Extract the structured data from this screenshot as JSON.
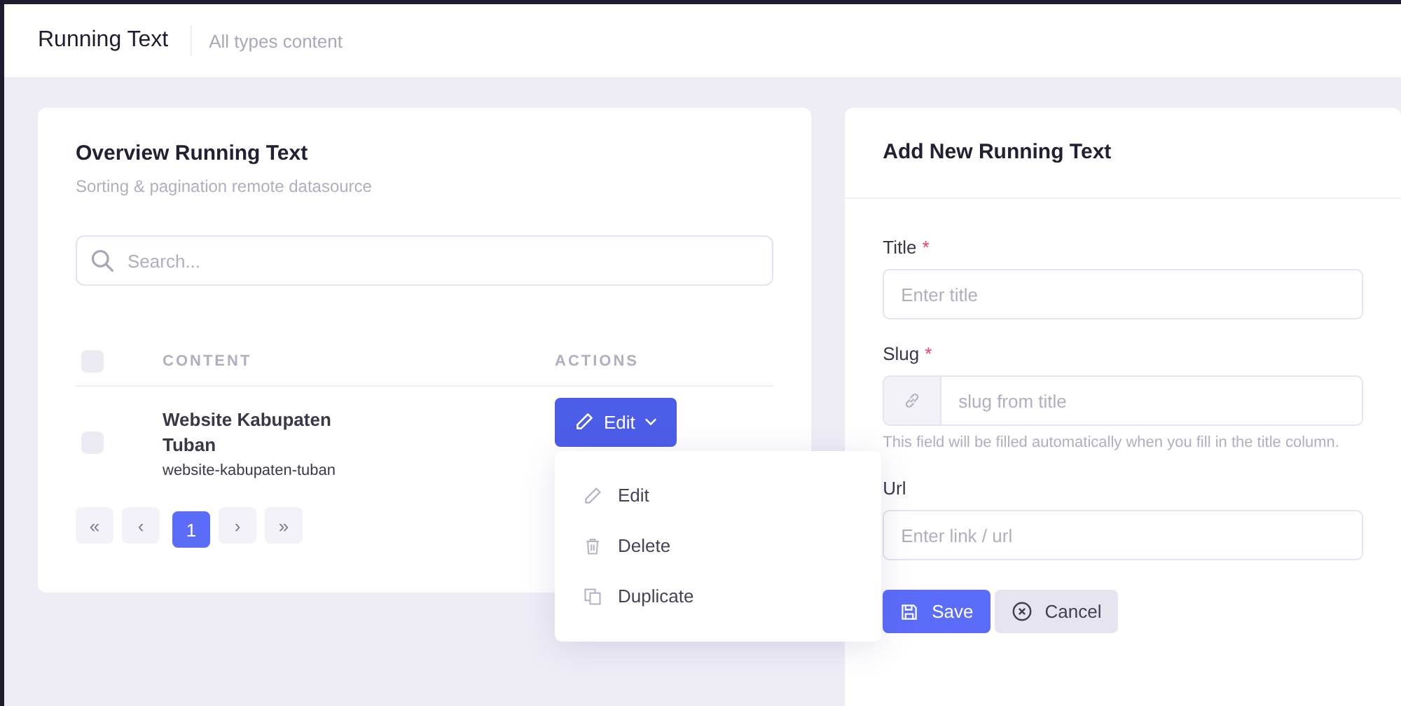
{
  "header": {
    "title": "Running Text",
    "subtitle": "All types content"
  },
  "overview": {
    "title": "Overview Running Text",
    "subtitle": "Sorting & pagination remote datasource",
    "search": {
      "placeholder": "Search..."
    },
    "table": {
      "select_all": {
        "checked": false
      },
      "columns": [
        "CONTENT",
        "ACTIONS"
      ],
      "rows": [
        {
          "checked": false,
          "title": "Website Kabupaten Tuban",
          "slug": "website-kabupaten-tuban",
          "action": "Edit",
          "menu_open": true
        }
      ]
    },
    "pagination": [
      {
        "label": "«",
        "kind": "nav",
        "selected": false
      },
      {
        "label": "‹",
        "kind": "nav",
        "selected": false
      },
      {
        "label": "1",
        "kind": "page",
        "selected": true
      },
      {
        "label": "›",
        "kind": "nav",
        "selected": false
      },
      {
        "label": "»",
        "kind": "nav",
        "selected": false
      }
    ]
  },
  "menu": [
    {
      "label": "Edit",
      "kind": "edit"
    },
    {
      "label": "Delete",
      "kind": "delete"
    },
    {
      "label": "Duplicate",
      "kind": "duplicate"
    }
  ],
  "form": {
    "title": "Add New Running Text",
    "fields": [
      {
        "label": "Title",
        "required_mark": "*",
        "kind": "text",
        "placeholder": "Enter title"
      },
      {
        "label": "Slug",
        "required_mark": "*",
        "kind": "link",
        "placeholder": "slug from title",
        "help": "This field will be filled automatically when you fill in the title column."
      },
      {
        "label": "Url",
        "kind": "text",
        "placeholder": "Enter link / url"
      }
    ],
    "buttons": [
      {
        "label": "Save",
        "kind": "primary"
      },
      {
        "label": "Cancel",
        "kind": "secondary"
      }
    ]
  }
}
